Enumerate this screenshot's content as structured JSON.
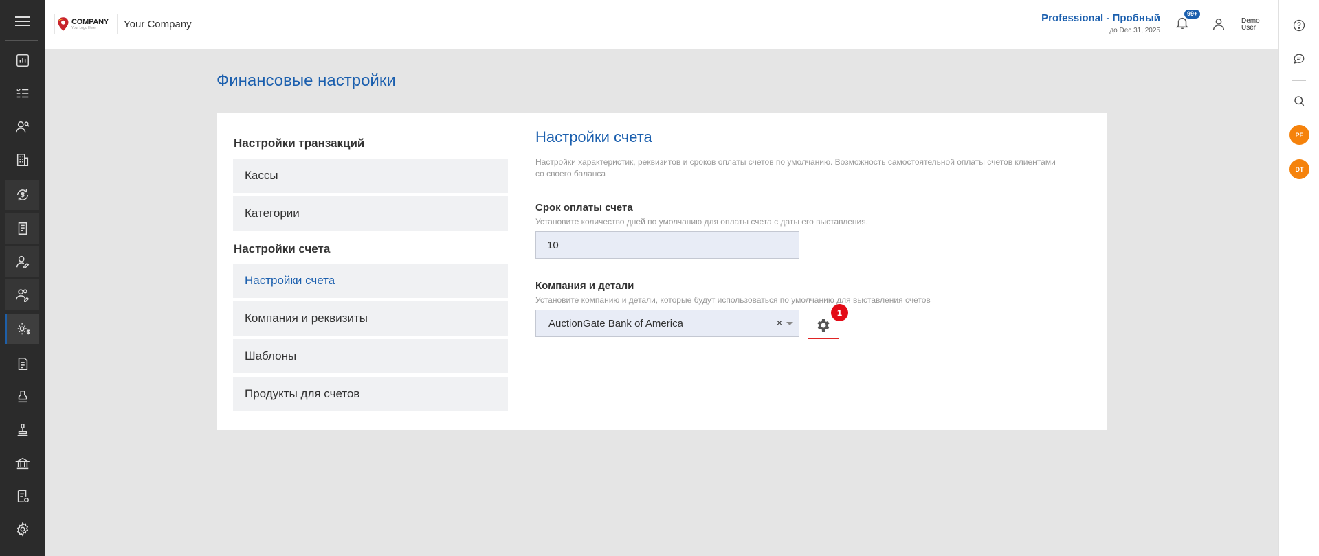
{
  "header": {
    "logo_text": "COMPANY",
    "logo_subtext": "Your Logo Here",
    "company_name": "Your Company",
    "plan_title": "Professional - Пробный",
    "plan_expiry": "до Dec 31, 2025",
    "notifications_badge": "99+",
    "user_name": "Demo User"
  },
  "sidebar": {
    "items": [
      {
        "icon": "dashboard-chart-icon"
      },
      {
        "icon": "task-list-icon"
      },
      {
        "icon": "users-search-icon"
      },
      {
        "icon": "building-icon"
      },
      {
        "icon": "dollar-exchange-icon"
      },
      {
        "icon": "ledger-book-icon"
      },
      {
        "icon": "user-edit-icon"
      },
      {
        "icon": "users-edit-icon"
      },
      {
        "icon": "settings-dollar-icon",
        "active": true
      },
      {
        "icon": "document-icon"
      },
      {
        "icon": "stamp-icon"
      },
      {
        "icon": "auction-gavel-icon"
      },
      {
        "icon": "bank-icon"
      },
      {
        "icon": "invoice-settings-icon"
      },
      {
        "icon": "gear-icon"
      }
    ]
  },
  "right_rail": {
    "items": [
      {
        "icon": "help-icon"
      },
      {
        "icon": "chat-icon"
      },
      {
        "icon": "search-icon"
      }
    ],
    "avatars": [
      "PE",
      "DT"
    ]
  },
  "page": {
    "title": "Финансовые настройки"
  },
  "nav": {
    "group1_title": "Настройки транзакций",
    "group1_items": [
      "Кассы",
      "Категории"
    ],
    "group2_title": "Настройки счета",
    "group2_items": [
      "Настройки счета",
      "Компания и реквизиты",
      "Шаблоны",
      "Продукты для счетов"
    ],
    "active_item": "Настройки счета"
  },
  "section": {
    "title": "Настройки счета",
    "description": "Настройки характеристик, реквизитов и сроков оплаты счетов по умолчанию. Возможность самостоятельной оплаты счетов клиентами со своего баланса",
    "due_label": "Срок оплаты счета",
    "due_hint": "Установите количество дней по умолчанию для оплаты счета с даты его выставления.",
    "due_value": "10",
    "company_label": "Компания и детали",
    "company_hint": "Установите компанию и детали, которые будут использоваться по умолчанию для выставления счетов",
    "company_value": "AuctionGate Bank of America",
    "clear_symbol": "×",
    "gear_badge": "1"
  },
  "colors": {
    "accent": "#1b5fae",
    "sidebar_bg": "#2b2b2b",
    "avatar": "#f5820b",
    "alert": "#e30b17"
  }
}
